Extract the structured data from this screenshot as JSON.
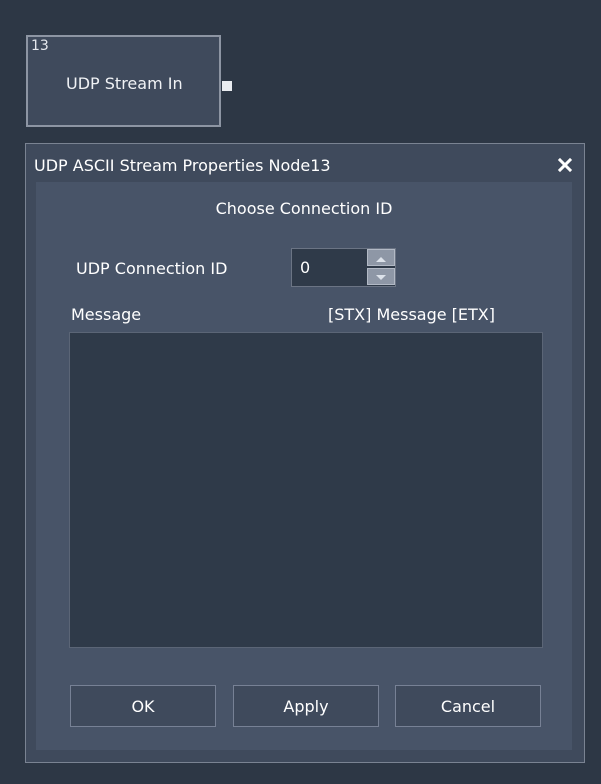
{
  "node": {
    "id": "13",
    "title": "UDP Stream In"
  },
  "dialog": {
    "title": "UDP ASCII Stream Properties Node13",
    "close_icon": "close-icon",
    "heading": "Choose Connection ID",
    "connection_label": "UDP Connection ID",
    "connection_value": "0",
    "message_label": "Message",
    "message_format": "[STX] Message [ETX]",
    "message_text": "",
    "buttons": {
      "ok": "OK",
      "apply": "Apply",
      "cancel": "Cancel"
    }
  },
  "colors": {
    "background": "#2d3745",
    "panel": "#3f4a5c",
    "client": "#485468",
    "field": "#2f3a49"
  }
}
